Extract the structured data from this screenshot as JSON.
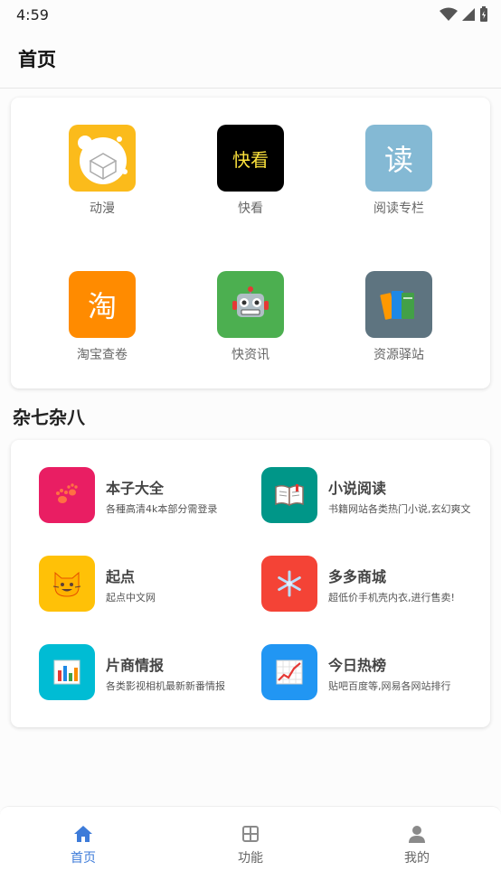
{
  "status_bar": {
    "time": "4:59"
  },
  "header": {
    "title": "首页"
  },
  "top_grid": {
    "items": [
      {
        "label": "动漫",
        "icon": "anime-icon",
        "color": "#fbbb1b"
      },
      {
        "label": "快看",
        "icon": "kuaikan-icon",
        "glyph": "快看",
        "color": "#000000",
        "glyph_color": "#fce23c"
      },
      {
        "label": "阅读专栏",
        "icon": "reading-icon",
        "glyph": "读",
        "color": "#84b9d4"
      },
      {
        "label": "淘宝查卷",
        "icon": "taobao-icon",
        "glyph": "淘",
        "color": "#ff8b00"
      },
      {
        "label": "快资讯",
        "icon": "robot-icon",
        "color": "#4caf50"
      },
      {
        "label": "资源驿站",
        "icon": "books-icon",
        "color": "#5e7480"
      }
    ]
  },
  "section": {
    "title": "杂七杂八"
  },
  "list": {
    "items": [
      {
        "title": "本子大全",
        "desc": "各種高清4k本部分需登录",
        "icon": "paw-icon",
        "color": "#e91e63"
      },
      {
        "title": "小说阅读",
        "desc": "书籍网站各类热门小说,玄幻爽文",
        "icon": "book-open-icon",
        "color": "#009688"
      },
      {
        "title": "起点",
        "desc": "起点中文网",
        "icon": "cat-face-icon",
        "color": "#ffc107"
      },
      {
        "title": "多多商城",
        "desc": "超低价手机壳内衣,进行售卖!",
        "icon": "snowflake-icon",
        "color": "#f44336"
      },
      {
        "title": "片商情报",
        "desc": "各类影视相机最新新番情报",
        "icon": "bar-chart-icon",
        "color": "#00bcd4"
      },
      {
        "title": "今日热榜",
        "desc": "贴吧百度等,网易各网站排行",
        "icon": "line-chart-icon",
        "color": "#2196f3"
      }
    ]
  },
  "bottom_nav": {
    "items": [
      {
        "label": "首页",
        "icon": "home-icon",
        "active": true
      },
      {
        "label": "功能",
        "icon": "grid-icon",
        "active": false
      },
      {
        "label": "我的",
        "icon": "person-icon",
        "active": false
      }
    ]
  },
  "colors": {
    "accent": "#3d7bd9",
    "inactive": "#8a8a8a"
  }
}
